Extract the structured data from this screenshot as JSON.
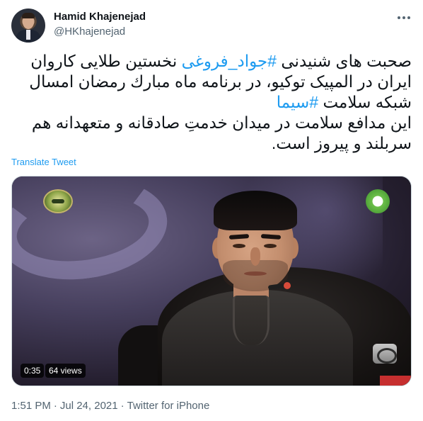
{
  "author": {
    "name": "Hamid Khajenejad",
    "handle": "@HKhajenejad"
  },
  "tweet": {
    "text_parts": [
      "صحبت های شنیدنی ",
      "#جواد_فروغی",
      " نخستین طلایی کاروان ایران در المپیک توکیو، در برنامه ماه مبارك رمضان امسال شبکه سلامت ",
      "#سیما",
      "\nاین مدافع سلامت در میدان خدمتِ صادقانه و متعهدانه هم سربلند و پیروز است."
    ],
    "translate_label": "Translate Tweet"
  },
  "media": {
    "duration": "0:35",
    "views": "64 views"
  },
  "meta": {
    "time": "1:51 PM",
    "separator": "·",
    "date": "Jul 24, 2021",
    "source": "Twitter for iPhone"
  },
  "colors": {
    "link": "#1d9bf0",
    "text": "#0f1419",
    "secondary": "#536471"
  },
  "icons": {
    "more": "more-horizontal-icon"
  }
}
